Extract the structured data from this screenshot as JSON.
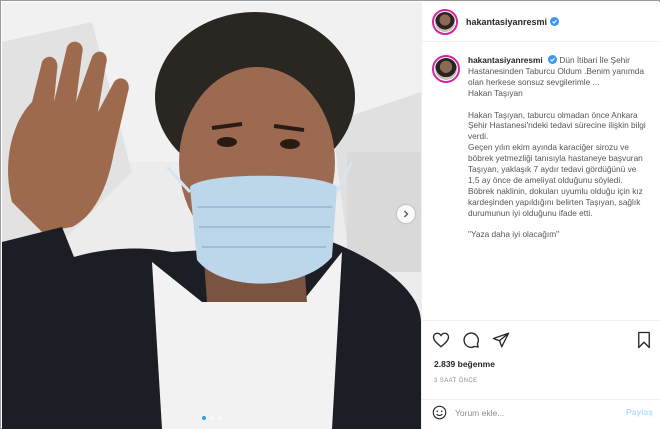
{
  "post": {
    "username": "hakantasiyanresmi",
    "verified": true,
    "image_alt": "",
    "carousel": {
      "dots": 3,
      "active_index": 0
    }
  },
  "caption": {
    "username": "hakantasiyanresmi",
    "paragraphs": [
      "Dün İtibari İle Şehir Hastanesinden Taburcu Oldum .Benim yanımda olan herkese sonsuz sevgilerimle ...",
      "Hakan Taşıyan",
      "",
      "Hakan Taşıyan, taburcu olmadan önce Ankara Şehir Hastanesi'ndeki tedavi sürecine ilişkin bilgi verdi.",
      "Geçen yılın ekim ayında karaciğer sirozu ve böbrek yetmezliği tanısıyla hastaneye başvuran Taşıyan, yaklaşık 7 aydır tedavi gördüğünü ve 1,5 ay önce de ameliyat olduğunu söyledi.",
      "Böbrek naklinin, dokuları uyumlu olduğu için kız kardeşinden yapıldığını belirten Taşıyan, sağlık durumunun iyi olduğunu ifade etti.",
      "",
      "\"Yaza daha iyi olacağım\""
    ]
  },
  "actions": {
    "icons": [
      "heart-icon",
      "comment-icon",
      "share-icon",
      "bookmark-icon"
    ],
    "likes": "2.839 beğenme",
    "timestamp": "3 SAAT ÖNCE"
  },
  "comment": {
    "placeholder": "Yorum ekle...",
    "post_label": "Paylaş"
  },
  "colors": {
    "verified": "#3897f0",
    "post_button": "#b2dffc",
    "border": "#efefef"
  }
}
